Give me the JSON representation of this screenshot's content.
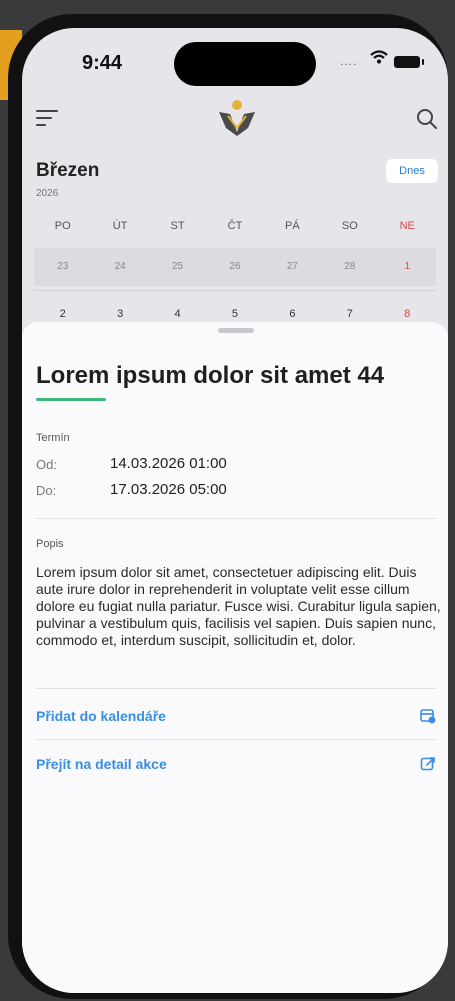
{
  "status_bar": {
    "time": "9:44",
    "signal": "....",
    "icons": [
      "wifi-icon",
      "battery-icon"
    ]
  },
  "header": {
    "icons": [
      "menu-icon",
      "logo",
      "search-icon"
    ]
  },
  "calendar": {
    "month": "Březen",
    "year": "2026",
    "today_label": "Dnes",
    "weekdays": [
      "PO",
      "ÚT",
      "ST",
      "ČT",
      "PÁ",
      "SO",
      "NE"
    ],
    "rows": [
      [
        "23",
        "24",
        "25",
        "26",
        "27",
        "28",
        "1"
      ],
      [
        "2",
        "3",
        "4",
        "5",
        "6",
        "7",
        "8"
      ]
    ]
  },
  "event": {
    "title": "Lorem ipsum dolor sit amet 44",
    "term_label": "Termín",
    "from_label": "Od:",
    "from_value": "14.03.2026 01:00",
    "to_label": "Do:",
    "to_value": "17.03.2026 05:00",
    "desc_label": "Popis",
    "description": "Lorem ipsum dolor sit amet, consectetuer adipiscing elit. Duis aute irure dolor in reprehenderit in voluptate velit esse cillum dolore eu fugiat nulla pariatur. Fusce wisi. Curabitur ligula sapien, pulvinar a vestibulum quis, facilisis vel sapien. Duis sapien nunc, commodo et, interdum suscipit, sollicitudin et, dolor.",
    "add_to_calendar": "Přidat do kalendáře",
    "go_to_detail": "Přejít na detail akce"
  },
  "colors": {
    "accent": "#3a8ee0",
    "underline": "#3cb878",
    "sunday": "#d94545"
  }
}
